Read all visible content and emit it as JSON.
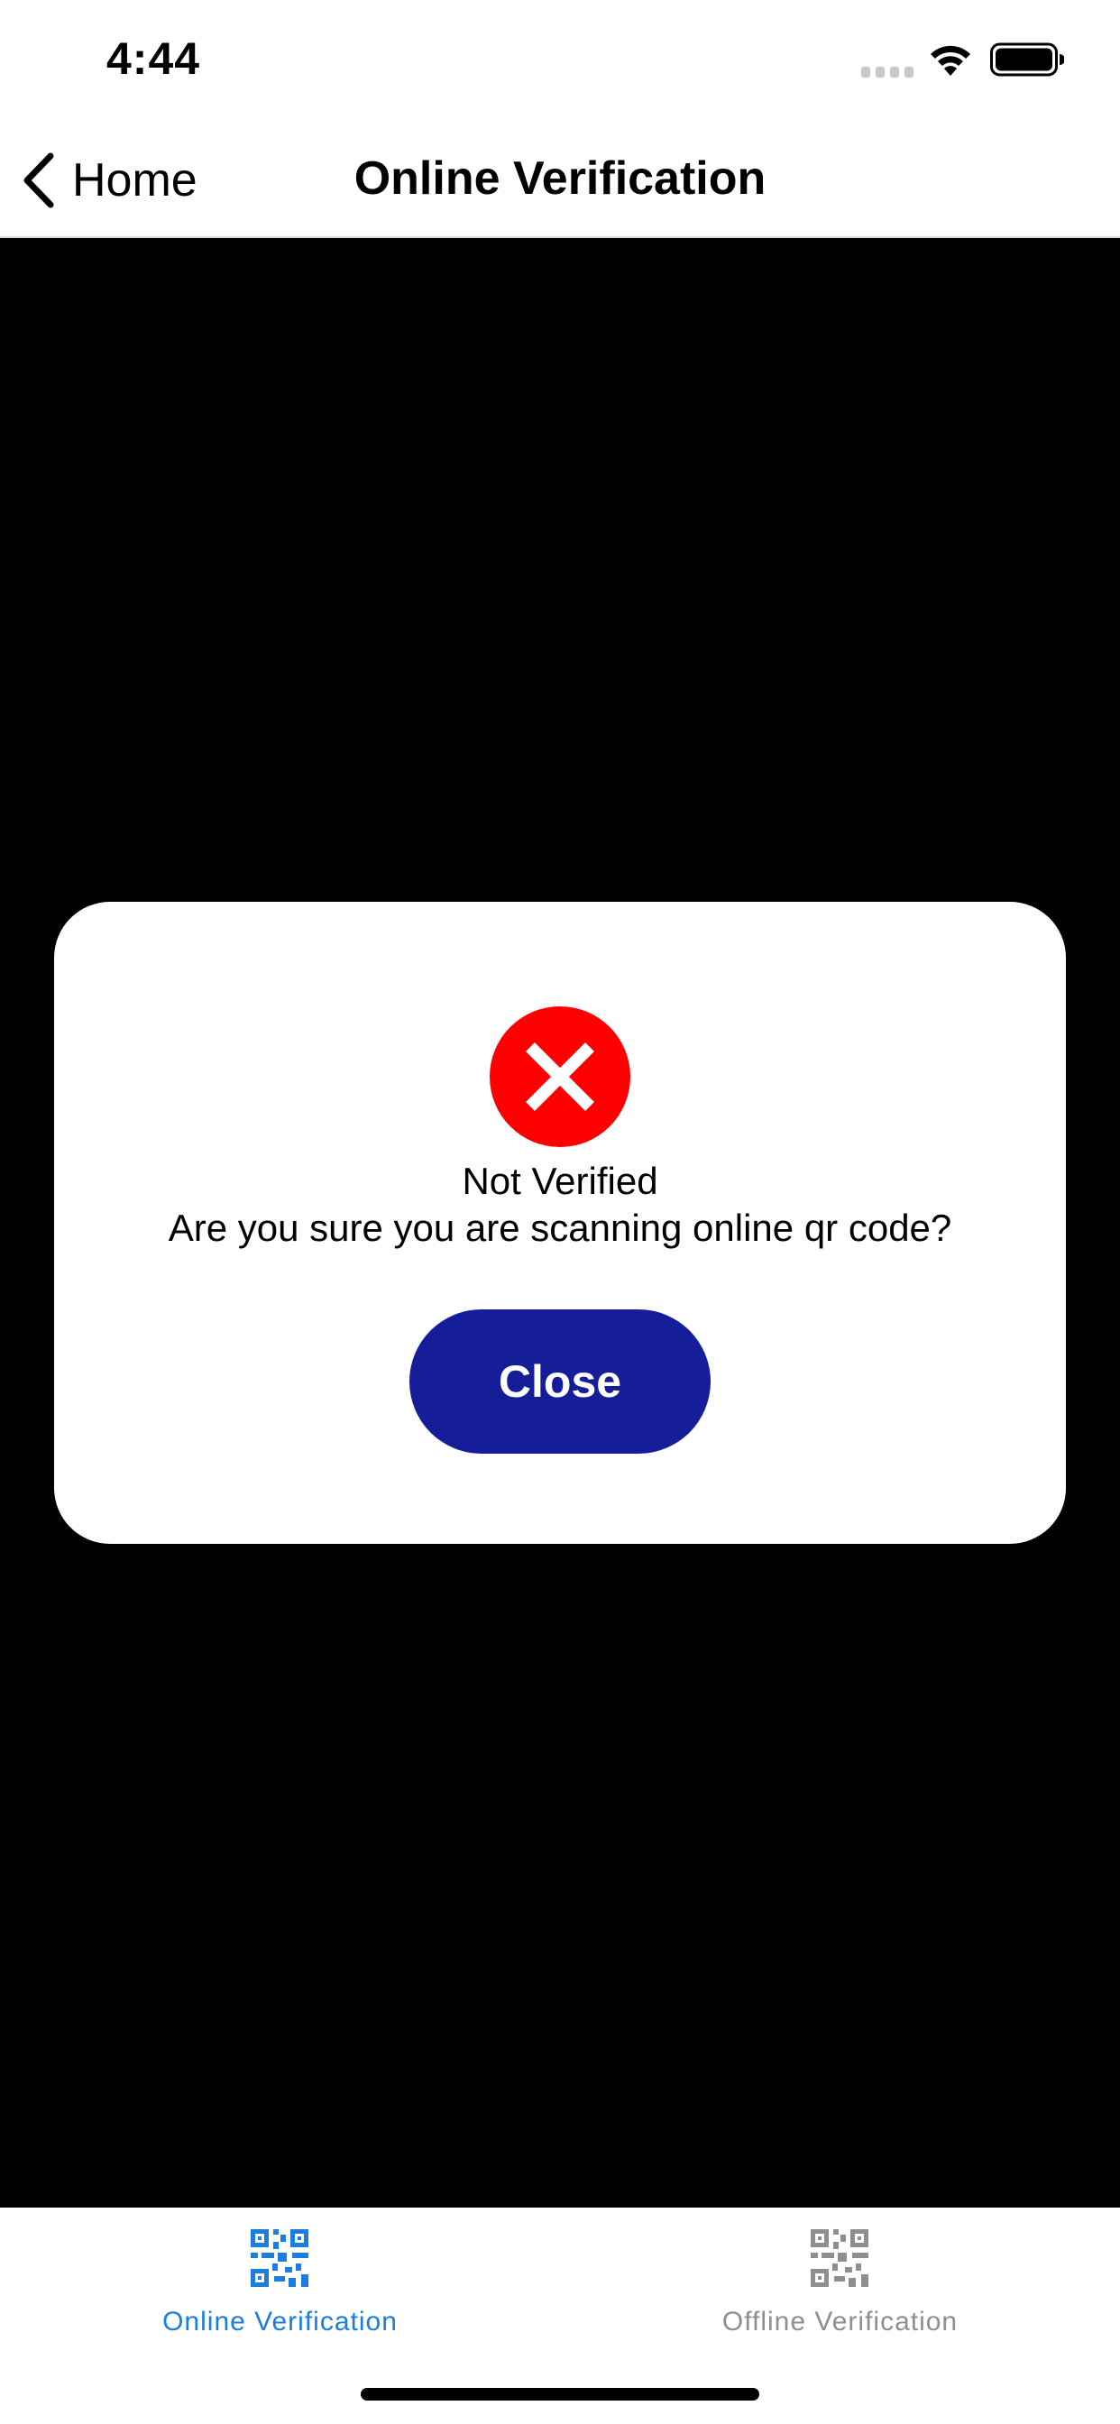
{
  "status_bar": {
    "time": "4:44"
  },
  "nav": {
    "back_label": "Home",
    "title": "Online Verification"
  },
  "modal": {
    "status_title": "Not Verified",
    "message": "Are you sure you are scanning online qr code?",
    "close_label": "Close",
    "icon": "x-circle-icon"
  },
  "tabs": [
    {
      "label": "Online Verification",
      "icon": "qr-code-icon",
      "selected": true
    },
    {
      "label": "Offline Verification",
      "icon": "qr-code-icon",
      "selected": false
    }
  ],
  "colors": {
    "accent": "#1b7de0",
    "inactive": "#8e8e93",
    "error": "#ff0000",
    "button": "#161d99"
  }
}
